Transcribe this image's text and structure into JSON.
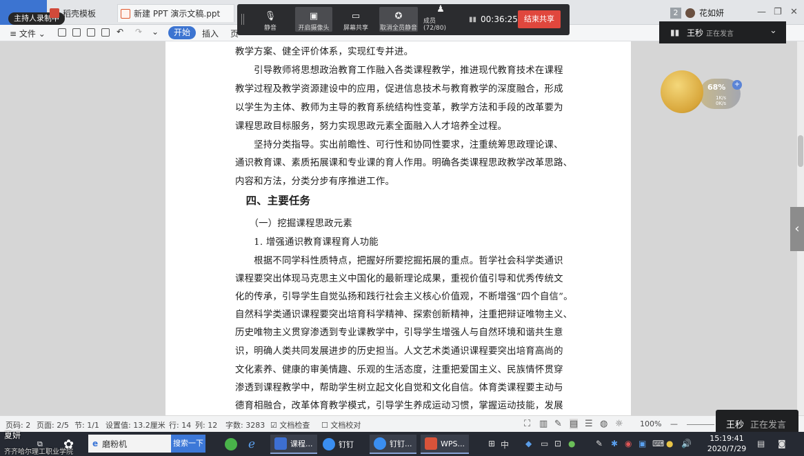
{
  "tabbar": {
    "recording_badge": "主持人录制中",
    "tabs": [
      {
        "label": "稻壳模板"
      },
      {
        "label": "新建 PPT 演示文稿.ppt"
      }
    ],
    "user_count": "2",
    "user_name": "花如妍"
  },
  "ribbon": {
    "file": "文件",
    "start": "开始",
    "insert": "插入",
    "more": "页"
  },
  "meeting": {
    "buttons": [
      {
        "label": "静音",
        "icon": "microphone-icon"
      },
      {
        "label": "开启摄像头",
        "icon": "camera-icon"
      },
      {
        "label": "屏幕共享",
        "icon": "share-screen-icon"
      },
      {
        "label": "取消全员静音",
        "icon": "mute-all-icon"
      },
      {
        "label": "成员(72/80)",
        "icon": "members-icon"
      }
    ],
    "timer": "00:36:25",
    "end_share": "结束共享"
  },
  "speaking": {
    "name": "王秒",
    "status": "正在发言"
  },
  "widget": {
    "percent": "68%",
    "up_rate": "1K/s",
    "down_rate": "0K/s"
  },
  "document": {
    "lines": [
      "教学方案、健全评价体系，实现红专并进。",
      "　　引导教师将思想政治教育工作融入各类课程教学，推进现代教育技术在课程",
      "教学过程及教学资源建设中的应用，促进信息技术与教育教学的深度融合，形成",
      "以学生为主体、教师为主导的教育系统结构性变革，教学方法和手段的改革要为",
      "课程思政目标服务，努力实现思政元素全面融入人才培养全过程。",
      "　　坚持分类指导。实出前瞻性、可行性和协同性要求，注重统筹思政理论课、",
      "通识教育课、素质拓展课和专业课的育人作用。明确各类课程思政教学改革思路、",
      "内容和方法，分类分步有序推进工作。",
      "　四、主要任务",
      "　　（一）挖掘课程思政元素",
      "　　1. 增强通识教育课程育人功能",
      "　　根据不同学科性质特点，把握好所要挖掘拓展的重点。哲学社会科学类通识",
      "课程要突出体现马克思主义中国化的最新理论成果，重视价值引导和优秀传统文",
      "化的传承，引导学生自觉弘扬和践行社会主义核心价值观，不断增强“四个自信”。",
      "自然科学类通识课程要突出培育科学精神、探索创新精神，注重把辩证唯物主义、",
      "历史唯物主义贯穿渗透到专业课教学中，引导学生增强人与自然环境和谐共生意",
      "识，明确人类共同发展进步的历史担当。人文艺术类通识课程要突出培育高尚的",
      "文化素养、健康的审美情趣、乐观的生活态度，注重把爱国主义、民族情怀贯穿",
      "渗透到课程教学中，帮助学生树立起文化自觉和文化自信。体育类课程要主动与",
      "德育相融合，改革体育教学模式，引导学生养成运动习惯，掌握运动技能，发展"
    ]
  },
  "statusbar": {
    "page_num": "页码: 2",
    "page": "页面: 2/5",
    "section": "节: 1/1",
    "setting": "设置值: 13.2厘米",
    "row": "行: 14",
    "col": "列: 12",
    "words": "字数: 3283",
    "spell": "文档检查",
    "proof": "文档校对",
    "zoom": "100%"
  },
  "taskbar": {
    "cam_name": "夏妍",
    "cam_sub": "齐齐哈尔理工职业学院",
    "search_text": "磨粉机",
    "search_button": "搜索一下",
    "apps": [
      {
        "label": "课程...",
        "color": "#3d6fd1"
      },
      {
        "label": "钉钉",
        "color": "#3a8ef0"
      },
      {
        "label": "钉钉...",
        "color": "#3a8ef0"
      },
      {
        "label": "WPS...",
        "color": "#d9533a"
      }
    ],
    "ime": "中",
    "time": "15:19:41",
    "date": "2020/7/29"
  }
}
